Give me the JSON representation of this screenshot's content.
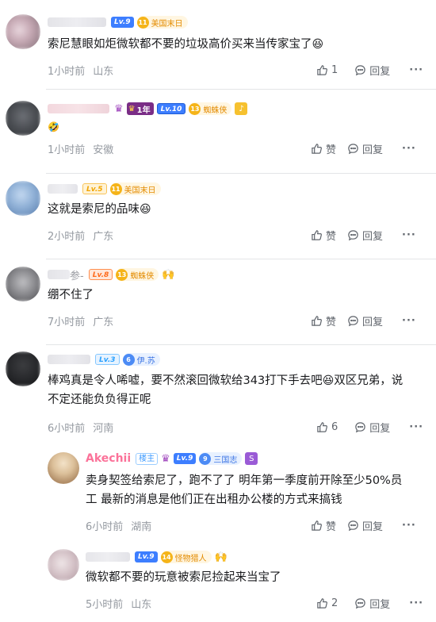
{
  "comments": [
    {
      "lv": "Lv.9",
      "fan_num": "11",
      "fan_name": "美国末日",
      "text": "索尼慧眼如炬微软都不要的垃圾高价买来当传家宝了",
      "time": "1小时前",
      "location": "山东",
      "like_label": "1",
      "reply_label": "回复"
    },
    {
      "badge_year": "1年",
      "lv": "Lv.10",
      "fan_num": "13",
      "fan_name": "蜘蛛侠",
      "time": "1小时前",
      "location": "安徽",
      "like_label": "赞",
      "reply_label": "回复"
    },
    {
      "lv": "Lv.5",
      "fan_num": "11",
      "fan_name": "美国末日",
      "text": "这就是索尼的品味",
      "time": "2小时前",
      "location": "广东",
      "like_label": "赞",
      "reply_label": "回复"
    },
    {
      "name_tail": "参-",
      "lv": "Lv.8",
      "fan_num": "13",
      "fan_name": "蜘蛛侠",
      "text": "绷不住了",
      "time": "7小时前",
      "location": "广东",
      "like_label": "赞",
      "reply_label": "回复"
    },
    {
      "lv": "Lv.3",
      "fan_num": "6",
      "fan_name": "伊.苏",
      "text_line1": "棒鸡真是令人唏嘘，要不然滚回微软给343打下手去吧",
      "text_line1_b": "双区兄弟，说",
      "text_line2": "不定还能负负得正呢",
      "time": "6小时前",
      "location": "河南",
      "like_label": "6",
      "reply_label": "回复"
    }
  ],
  "replies": [
    {
      "username": "Akechii",
      "up_tag": "楼主",
      "lv": "Lv.9",
      "fan_num": "9",
      "fan_name": "三国志",
      "text_line1": "卖身契签给索尼了，跑不了了 明年第一季度前开除至少50%员",
      "text_line2": "工 最新的消息是他们正在出租办公楼的方式来搞钱",
      "time": "6小时前",
      "location": "湖南",
      "like_label": "赞",
      "reply_label": "回复"
    },
    {
      "lv": "Lv.9",
      "fan_num": "14",
      "fan_name": "怪物猎人",
      "text": "微软都不要的玩意被索尼捡起来当宝了",
      "time": "5小时前",
      "location": "山东",
      "like_label": "2",
      "reply_label": "回复"
    }
  ],
  "more_label": "···",
  "colors": {
    "accent_pink": "#fb7299",
    "level_blue": "#3d7eff",
    "fan_gold": "#f5b419"
  },
  "icons": {
    "like": "thumbs-up-icon",
    "reply": "reply-bubble-icon",
    "more": "more-dots-icon"
  }
}
